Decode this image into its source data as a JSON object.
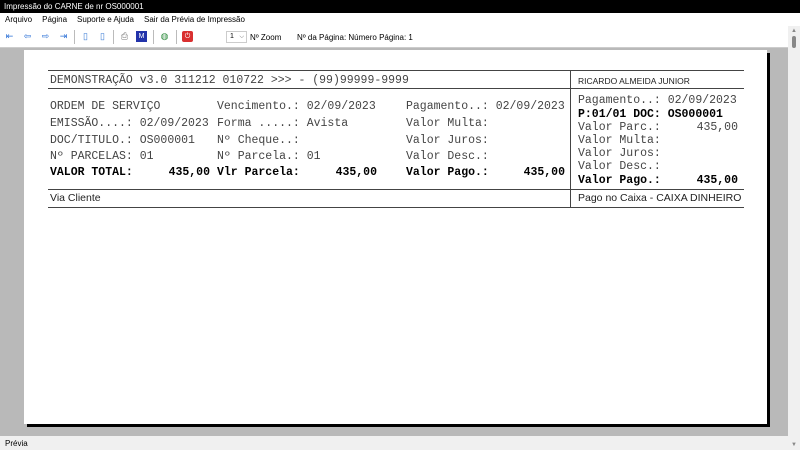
{
  "window": {
    "title": "Impressão do CARNE de nr OS000001"
  },
  "menu": [
    "Arquivo",
    "Página",
    "Suporte e Ajuda",
    "Sair da Prévia de Impressão"
  ],
  "toolbar": {
    "zoom_value": "1",
    "zoom_label": "Nº Zoom",
    "page_label": "Nº da Página: Número Página: 1"
  },
  "receipt": {
    "header": "DEMONSTRAÇÃO v3.0 311212 010722 >>> - (99)99999-9999",
    "customer": "RICARDO ALMEIDA JUNIOR",
    "rows": [
      [
        "ORDEM DE SERVIÇO",
        "Vencimento.: 02/09/2023",
        "Pagamento..: 02/09/2023"
      ],
      [
        "EMISSÃO....: 02/09/2023",
        "Forma .....: Avista",
        "Valor Multa:"
      ],
      [
        "DOC/TITULO.: OS000001",
        "Nº Cheque..:",
        "Valor Juros:"
      ],
      [
        "Nº PARCELAS: 01",
        "Nº Parcela.: 01",
        "Valor Desc.:"
      ]
    ],
    "totals": {
      "total_label": "VALOR TOTAL:",
      "total_value": "435,00",
      "parcela_label": "Vlr Parcela:",
      "parcela_value": "435,00",
      "pago_label": "Valor Pago.:",
      "pago_value": "435,00"
    },
    "via": "Via Cliente",
    "stub": {
      "pagamento": "Pagamento..: 02/09/2023",
      "doc": "P:01/01 DOC: OS000001",
      "parc_label": "Valor Parc.:",
      "parc_value": "435,00",
      "multa": "Valor Multa:",
      "juros": "Valor Juros:",
      "desc": "Valor Desc.:",
      "pago_label": "Valor Pago.:",
      "pago_value": "435,00",
      "caixa": "Pago no Caixa - CAIXA DINHEIRO"
    }
  },
  "status": "Prévia"
}
